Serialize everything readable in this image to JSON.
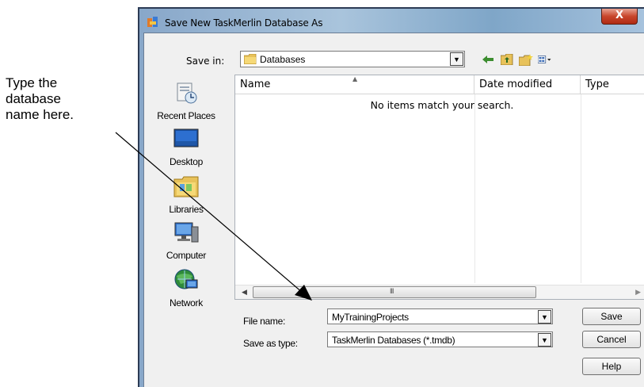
{
  "annotation": {
    "lines": [
      "Type the",
      "database",
      "name here."
    ]
  },
  "dialog": {
    "title": "Save New TaskMerlin Database As",
    "close_label": "X",
    "save_in_label": "Save in:",
    "save_in_value": "Databases",
    "toolbar_icons": [
      "back-arrow-icon",
      "up-folder-icon",
      "new-folder-icon",
      "views-menu-icon"
    ]
  },
  "places": [
    {
      "label": "Recent Places",
      "icon": "recent-places-icon"
    },
    {
      "label": "Desktop",
      "icon": "desktop-icon"
    },
    {
      "label": "Libraries",
      "icon": "libraries-icon"
    },
    {
      "label": "Computer",
      "icon": "computer-icon"
    },
    {
      "label": "Network",
      "icon": "network-icon"
    }
  ],
  "file_list": {
    "columns": [
      "Name",
      "Date modified",
      "Type"
    ],
    "empty_message": "No items match your search.",
    "scroll_grip": "III"
  },
  "form": {
    "file_name_label": "File name:",
    "file_name_value": "MyTrainingProjects",
    "save_as_type_label": "Save as type:",
    "save_as_type_value": "TaskMerlin Databases (*.tmdb)"
  },
  "buttons": {
    "save": "Save",
    "cancel": "Cancel",
    "help": "Help"
  },
  "colors": {
    "titlebar_glass": "#a9c4dc",
    "client_bg": "#f0f0f0",
    "close_button": "#c8462c"
  }
}
